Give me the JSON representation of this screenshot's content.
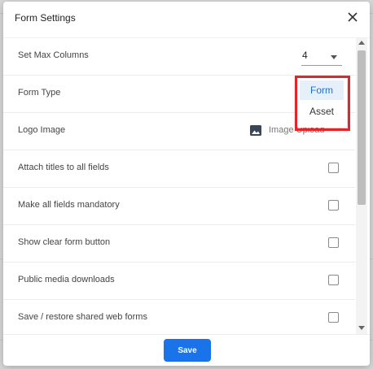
{
  "dialog": {
    "title": "Form Settings",
    "save_label": "Save"
  },
  "settings": {
    "max_columns": {
      "label": "Set Max Columns",
      "value": "4"
    },
    "form_type": {
      "label": "Form Type",
      "options": [
        "Form",
        "Asset"
      ],
      "selected": "Form"
    },
    "logo_image": {
      "label": "Logo Image",
      "upload_label": "Image Upload"
    },
    "checkbox_rows": [
      {
        "label": "Attach titles to all fields",
        "checked": false
      },
      {
        "label": "Make all fields mandatory",
        "checked": false
      },
      {
        "label": "Show clear form button",
        "checked": false
      },
      {
        "label": "Public media downloads",
        "checked": false
      },
      {
        "label": "Save / restore shared web forms",
        "checked": false
      }
    ]
  },
  "colors": {
    "accent": "#1a73e8",
    "highlight_border": "#e3242b",
    "selected_option_bg": "#e6f0fb"
  },
  "icons": {
    "close": "close-icon",
    "logo": "image-icon",
    "dropdown": "chevron-down-icon"
  }
}
